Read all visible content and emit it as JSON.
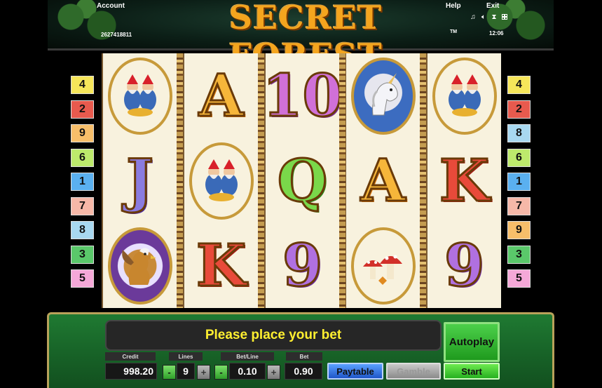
{
  "header": {
    "title": "SECRET FOREST",
    "trademark": "TM",
    "account_label": "Account",
    "account_number": "2627418811",
    "help_label": "Help",
    "exit_label": "Exit",
    "time": "12:06",
    "icons": [
      "music-icon",
      "speaker-icon",
      "hourglass-icon",
      "fullscreen-icon"
    ]
  },
  "line_indicators": {
    "left": [
      {
        "number": "4",
        "color": "#f6e65a"
      },
      {
        "number": "2",
        "color": "#e85a4e"
      },
      {
        "number": "9",
        "color": "#f7be6a"
      },
      {
        "number": "6",
        "color": "#bdea6c"
      },
      {
        "number": "1",
        "color": "#5ab0f0"
      },
      {
        "number": "7",
        "color": "#f6b8a8"
      },
      {
        "number": "8",
        "color": "#a8d8f0"
      },
      {
        "number": "3",
        "color": "#5ac86a"
      },
      {
        "number": "5",
        "color": "#f5a8d8"
      }
    ],
    "right": [
      {
        "number": "4",
        "color": "#f6e65a"
      },
      {
        "number": "2",
        "color": "#e85a4e"
      },
      {
        "number": "8",
        "color": "#a8d8f0"
      },
      {
        "number": "6",
        "color": "#bdea6c"
      },
      {
        "number": "1",
        "color": "#5ab0f0"
      },
      {
        "number": "7",
        "color": "#f6b8a8"
      },
      {
        "number": "9",
        "color": "#f7be6a"
      },
      {
        "number": "3",
        "color": "#5ac86a"
      },
      {
        "number": "5",
        "color": "#f5a8d8"
      }
    ]
  },
  "reels": [
    [
      "gnomes",
      "J",
      "griffin"
    ],
    [
      "A",
      "gnomes",
      "K"
    ],
    [
      "10",
      "Q",
      "9"
    ],
    [
      "unicorn",
      "A",
      "mushrooms"
    ],
    [
      "gnomes",
      "K",
      "9"
    ]
  ],
  "panel": {
    "message": "Please place your bet",
    "credit_label": "Credit",
    "credit_value": "998.20",
    "lines_label": "Lines",
    "lines_value": "9",
    "betline_label": "Bet/Line",
    "betline_value": "0.10",
    "bet_label": "Bet",
    "bet_value": "0.90",
    "minus": "-",
    "plus": "+",
    "autoplay": "Autoplay",
    "paytable": "Paytable",
    "gamble": "Gamble",
    "start": "Start"
  }
}
